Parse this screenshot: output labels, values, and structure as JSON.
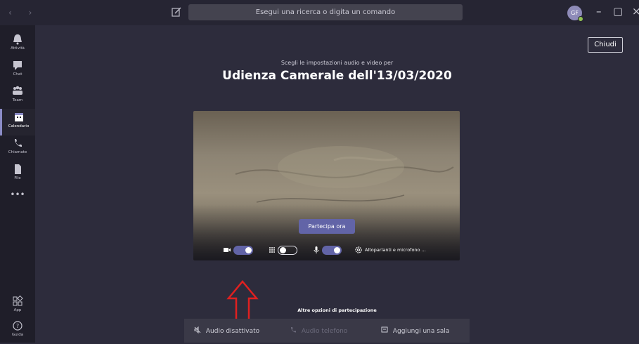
{
  "titlebar": {
    "nav": "‹ ›",
    "search_placeholder": "Esegui una ricerca o digita un comando",
    "avatar_initials": "GF"
  },
  "rail": {
    "items": [
      {
        "label": "Attività",
        "icon": "bell-icon"
      },
      {
        "label": "Chat",
        "icon": "chat-icon"
      },
      {
        "label": "Team",
        "icon": "teams-icon"
      },
      {
        "label": "Calendario",
        "icon": "calendar-icon",
        "active": true
      },
      {
        "label": "Chiamate",
        "icon": "phone-icon"
      },
      {
        "label": "File",
        "icon": "file-icon"
      },
      {
        "label": "•••",
        "icon": "more-icon"
      },
      {
        "label": "App",
        "icon": "apps-icon"
      },
      {
        "label": "Guida",
        "icon": "help-icon"
      }
    ]
  },
  "main": {
    "close_label": "Chiudi",
    "subtitle": "Scegli le impostazioni audio e video per",
    "title": "Udienza Camerale dell'13/03/2020",
    "join_label": "Partecipa ora",
    "speaker_label": "Altoparlanti e microfono ...",
    "other_options_title": "Altre opzioni di partecipazione",
    "options": {
      "audio_off": "Audio disattivato",
      "phone_audio": "Audio telefono",
      "add_room": "Aggiungi una sala"
    }
  },
  "state": {
    "camera_on": true,
    "blur_on": false,
    "mic_on": true
  },
  "colors": {
    "accent": "#6264a7",
    "arrow": "#e02020"
  }
}
